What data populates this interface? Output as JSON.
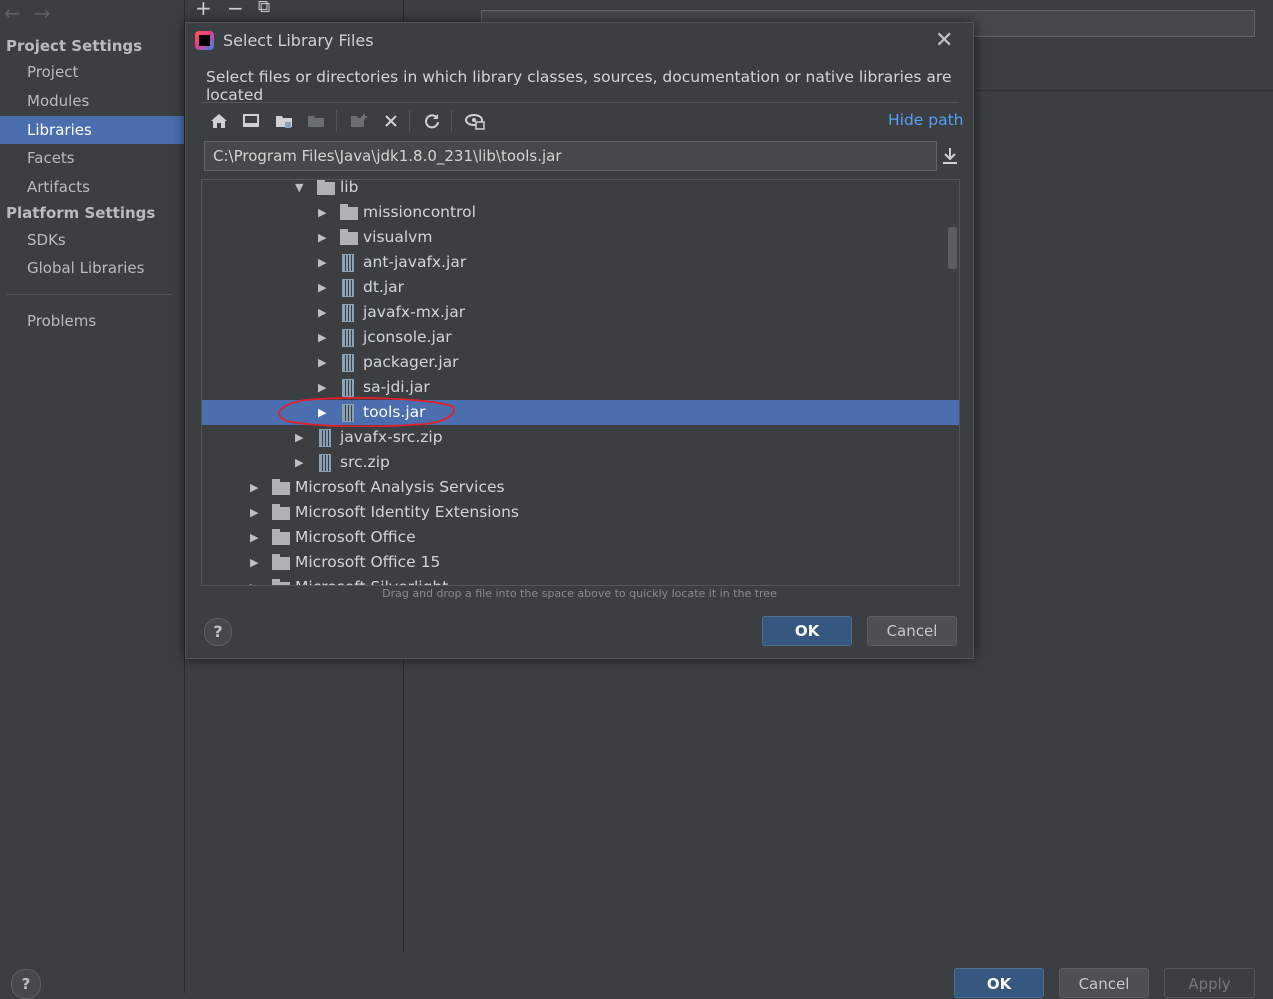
{
  "settings": {
    "nav": {
      "back": "←",
      "forward": "→"
    },
    "toolbar": {
      "add": "+",
      "remove": "−",
      "copy": "⧉"
    },
    "project_settings_title": "Project Settings",
    "project_items": [
      "Project",
      "Modules",
      "Libraries",
      "Facets",
      "Artifacts"
    ],
    "selected_item": "Libraries",
    "platform_settings_title": "Platform Settings",
    "platform_items": [
      "SDKs",
      "Global Libraries"
    ],
    "problems": "Problems",
    "help": "?",
    "ok": "OK",
    "cancel": "Cancel",
    "apply": "Apply"
  },
  "dialog": {
    "title": "Select Library Files",
    "close": "✕",
    "description": "Select files or directories in which library classes, sources, documentation or native libraries are located",
    "hide_path": "Hide path",
    "path_value": "C:\\Program Files\\Java\\jdk1.8.0_231\\lib\\tools.jar",
    "hint": "Drag and drop a file into the space above to quickly locate it in the tree",
    "help": "?",
    "ok": "OK",
    "cancel": "Cancel",
    "toolbar_icons": [
      "home-icon",
      "desktop-icon",
      "project-folder-icon",
      "module-folder-icon",
      "new-folder-icon",
      "delete-icon",
      "refresh-icon",
      "show-hidden-icon"
    ],
    "tree": [
      {
        "label": "lib",
        "type": "folder",
        "depth": 4,
        "expanded": true
      },
      {
        "label": "missioncontrol",
        "type": "folder",
        "depth": 5
      },
      {
        "label": "visualvm",
        "type": "folder",
        "depth": 5
      },
      {
        "label": "ant-javafx.jar",
        "type": "jar",
        "depth": 5
      },
      {
        "label": "dt.jar",
        "type": "jar",
        "depth": 5
      },
      {
        "label": "javafx-mx.jar",
        "type": "jar",
        "depth": 5
      },
      {
        "label": "jconsole.jar",
        "type": "jar",
        "depth": 5
      },
      {
        "label": "packager.jar",
        "type": "jar",
        "depth": 5
      },
      {
        "label": "sa-jdi.jar",
        "type": "jar",
        "depth": 5
      },
      {
        "label": "tools.jar",
        "type": "jar",
        "depth": 5,
        "selected": true
      },
      {
        "label": "javafx-src.zip",
        "type": "jar",
        "depth": 4
      },
      {
        "label": "src.zip",
        "type": "jar",
        "depth": 4
      },
      {
        "label": "Microsoft Analysis Services",
        "type": "folder",
        "depth": 3
      },
      {
        "label": "Microsoft Identity Extensions",
        "type": "folder",
        "depth": 3
      },
      {
        "label": "Microsoft Office",
        "type": "folder",
        "depth": 3
      },
      {
        "label": "Microsoft Office 15",
        "type": "folder",
        "depth": 3
      },
      {
        "label": "Microsoft Silverlight",
        "type": "folder",
        "depth": 3
      }
    ]
  },
  "colors": {
    "background": "#3c3f41",
    "selection": "#4b6eaf",
    "link": "#589df6",
    "primary_button": "#365880",
    "annotation": "#e0202a"
  }
}
